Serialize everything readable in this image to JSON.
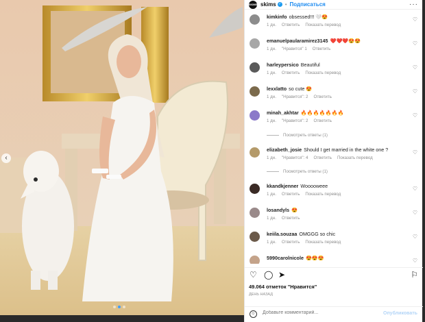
{
  "header": {
    "avatar_text": "SKIMS",
    "username": "skims",
    "follow_label": "Подписаться",
    "more": "···"
  },
  "comments": [
    {
      "user": "kimkinfo",
      "text": "obsessed!!! 🤍😍",
      "time": "1 дн.",
      "likes": "",
      "reply": "Ответить",
      "translate": "Показать перевод",
      "avatar_color": "#8c8c8c"
    },
    {
      "user": "emanuelpaularamirez3145",
      "text": "❤️❤️❤️😍😍",
      "time": "1 дн.",
      "likes": "\"Нравится\" 1",
      "reply": "Ответить",
      "translate": "",
      "avatar_color": "#a7a7a7"
    },
    {
      "user": "harleypersico",
      "text": "Beautiful",
      "time": "1 дн.",
      "likes": "",
      "reply": "Ответить",
      "translate": "Показать перевод",
      "avatar_color": "#5a5a5a"
    },
    {
      "user": "lexxlatto",
      "text": "so cute 😍",
      "time": "1 дн.",
      "likes": "\"Нравится\": 2",
      "reply": "Ответить",
      "translate": "",
      "avatar_color": "#7b6a4c"
    },
    {
      "user": "minah_akhtar",
      "text": "🔥🔥🔥🔥🔥🔥🔥",
      "time": "1 дн.",
      "likes": "\"Нравится\": 2",
      "reply": "Ответить",
      "translate": "",
      "avatar_color": "#8b79c9"
    },
    {
      "user": "elizabeth_josie",
      "text": "Should I get married in the white one ?",
      "time": "1 дн.",
      "likes": "\"Нравится\": 4",
      "reply": "Ответить",
      "translate": "Показать перевод",
      "avatar_color": "#b49a6a"
    },
    {
      "user": "kkandkjenner",
      "text": "Wooooweee",
      "time": "1 дн.",
      "likes": "",
      "reply": "Ответить",
      "translate": "Показать перевод",
      "avatar_color": "#3a2a25"
    },
    {
      "user": "losandyls",
      "text": "😍",
      "time": "1 дн.",
      "likes": "",
      "reply": "Ответить",
      "translate": "",
      "avatar_color": "#9a8a8a"
    },
    {
      "user": "keiila.souzaa",
      "text": "OMGGG so chic",
      "time": "1 дн.",
      "likes": "",
      "reply": "Ответить",
      "translate": "Показать перевод",
      "avatar_color": "#6b5a4a"
    },
    {
      "user": "5990carolnicole",
      "text": "😍😍😍",
      "time": "",
      "likes": "",
      "reply": "",
      "translate": "",
      "avatar_color": "#c4a38a"
    }
  ],
  "view_replies": [
    {
      "label": "Посмотреть ответы (1)"
    },
    {
      "label": "Посмотреть ответы (1)"
    }
  ],
  "actions": {
    "likes_text": "49.064 отметок \"Нравится\"",
    "date_text": "ДЕНЬ НАЗАД",
    "comment_placeholder": "Добавьте комментарий...",
    "publish_label": "Опубликовать"
  },
  "icons": [
    "heart-icon",
    "comment-icon",
    "share-icon",
    "bookmark-icon",
    "emoji-icon"
  ],
  "colors": {
    "accent": "#1d8bf0",
    "publish_disabled": "#b3d5f7"
  }
}
